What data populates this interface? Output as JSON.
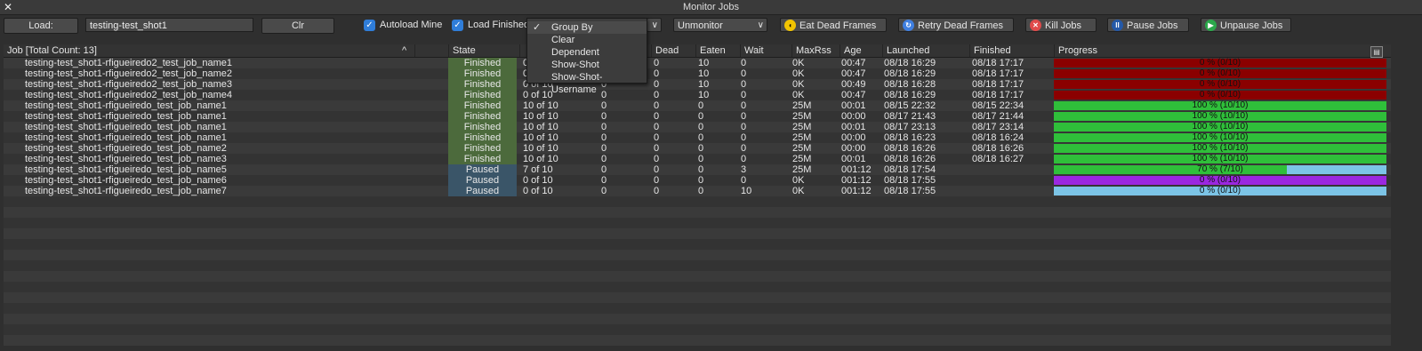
{
  "window": {
    "title": "Monitor Jobs",
    "close_glyph": "✕"
  },
  "toolbar": {
    "load_label": "Load:",
    "search_value": "testing-test_shot1",
    "clear_label": "Clr",
    "autoload_mine_label": "Autoload Mine",
    "autoload_mine_checked": true,
    "load_finished_label": "Load Finished",
    "load_finished_checked": true,
    "unmonitor_label": "Unmonitor",
    "eat_dead_label": "Eat Dead Frames",
    "retry_dead_label": "Retry Dead Frames",
    "kill_label": "Kill Jobs",
    "pause_label": "Pause Jobs",
    "unpause_label": "Unpause Jobs"
  },
  "dropdown": {
    "items": [
      "Group By",
      "Clear",
      "Dependent",
      "Show-Shot",
      "Show-Shot-Username"
    ],
    "checked_item": "Group By"
  },
  "columns": {
    "job": "Job [Total Count: 13]",
    "sort_glyph": "^",
    "state": "State",
    "dead": "Dead",
    "eaten": "Eaten",
    "wait": "Wait",
    "maxrss": "MaxRss",
    "age": "Age",
    "launched": "Launched",
    "finished": "Finished",
    "progress": "Progress"
  },
  "colors": {
    "finished_state": "#4c6a3c",
    "paused_state": "#3a5568",
    "progress_red": "#8b0000",
    "progress_green": "#2fbf3a",
    "progress_purple": "#9b27e0",
    "progress_remaining": "#7cc4e6"
  },
  "jobs": [
    {
      "name": "testing-test_shot1-rfigueiredo2_test_job_name1",
      "state": "Finished",
      "done": "0",
      "c2": "0",
      "dead": "0",
      "eaten": "10",
      "wait": "0",
      "maxrss": "0K",
      "age": "00:47",
      "launched": "08/18 16:29",
      "finished": "08/18 17:17",
      "progress": "0 % (0/10)",
      "fill_pct": 100,
      "fill_color": "red"
    },
    {
      "name": "testing-test_shot1-rfigueiredo2_test_job_name2",
      "state": "Finished",
      "done": "0",
      "c2": "0",
      "dead": "0",
      "eaten": "10",
      "wait": "0",
      "maxrss": "0K",
      "age": "00:47",
      "launched": "08/18 16:29",
      "finished": "08/18 17:17",
      "progress": "0 % (0/10)",
      "fill_pct": 100,
      "fill_color": "red"
    },
    {
      "name": "testing-test_shot1-rfigueiredo2_test_job_name3",
      "state": "Finished",
      "done": "0 of 10",
      "c2": "0",
      "dead": "0",
      "eaten": "10",
      "wait": "0",
      "maxrss": "0K",
      "age": "00:49",
      "launched": "08/18 16:28",
      "finished": "08/18 17:17",
      "progress": "0 % (0/10)",
      "fill_pct": 100,
      "fill_color": "red"
    },
    {
      "name": "testing-test_shot1-rfigueiredo2_test_job_name4",
      "state": "Finished",
      "done": "0 of 10",
      "c2": "0",
      "dead": "0",
      "eaten": "10",
      "wait": "0",
      "maxrss": "0K",
      "age": "00:47",
      "launched": "08/18 16:29",
      "finished": "08/18 17:17",
      "progress": "0 % (0/10)",
      "fill_pct": 100,
      "fill_color": "red"
    },
    {
      "name": "testing-test_shot1-rfigueiredo_test_job_name1",
      "state": "Finished",
      "done": "10 of 10",
      "c2": "0",
      "dead": "0",
      "eaten": "0",
      "wait": "0",
      "maxrss": "25M",
      "age": "00:01",
      "launched": "08/15 22:32",
      "finished": "08/15 22:34",
      "progress": "100 % (10/10)",
      "fill_pct": 100,
      "fill_color": "green"
    },
    {
      "name": "testing-test_shot1-rfigueiredo_test_job_name1",
      "state": "Finished",
      "done": "10 of 10",
      "c2": "0",
      "dead": "0",
      "eaten": "0",
      "wait": "0",
      "maxrss": "25M",
      "age": "00:00",
      "launched": "08/17 21:43",
      "finished": "08/17 21:44",
      "progress": "100 % (10/10)",
      "fill_pct": 100,
      "fill_color": "green"
    },
    {
      "name": "testing-test_shot1-rfigueiredo_test_job_name1",
      "state": "Finished",
      "done": "10 of 10",
      "c2": "0",
      "dead": "0",
      "eaten": "0",
      "wait": "0",
      "maxrss": "25M",
      "age": "00:01",
      "launched": "08/17 23:13",
      "finished": "08/17 23:14",
      "progress": "100 % (10/10)",
      "fill_pct": 100,
      "fill_color": "green"
    },
    {
      "name": "testing-test_shot1-rfigueiredo_test_job_name1",
      "state": "Finished",
      "done": "10 of 10",
      "c2": "0",
      "dead": "0",
      "eaten": "0",
      "wait": "0",
      "maxrss": "25M",
      "age": "00:00",
      "launched": "08/18 16:23",
      "finished": "08/18 16:24",
      "progress": "100 % (10/10)",
      "fill_pct": 100,
      "fill_color": "green"
    },
    {
      "name": "testing-test_shot1-rfigueiredo_test_job_name2",
      "state": "Finished",
      "done": "10 of 10",
      "c2": "0",
      "dead": "0",
      "eaten": "0",
      "wait": "0",
      "maxrss": "25M",
      "age": "00:00",
      "launched": "08/18 16:26",
      "finished": "08/18 16:26",
      "progress": "100 % (10/10)",
      "fill_pct": 100,
      "fill_color": "green"
    },
    {
      "name": "testing-test_shot1-rfigueiredo_test_job_name3",
      "state": "Finished",
      "done": "10 of 10",
      "c2": "0",
      "dead": "0",
      "eaten": "0",
      "wait": "0",
      "maxrss": "25M",
      "age": "00:01",
      "launched": "08/18 16:26",
      "finished": "08/18 16:27",
      "progress": "100 % (10/10)",
      "fill_pct": 100,
      "fill_color": "green"
    },
    {
      "name": "testing-test_shot1-rfigueiredo_test_job_name5",
      "state": "Paused",
      "done": "7 of 10",
      "c2": "0",
      "dead": "0",
      "eaten": "0",
      "wait": "3",
      "maxrss": "25M",
      "age": "001:12",
      "launched": "08/18 17:54",
      "finished": "",
      "progress": "70 % (7/10)",
      "fill_pct": 70,
      "fill_color": "green"
    },
    {
      "name": "testing-test_shot1-rfigueiredo_test_job_name6",
      "state": "Paused",
      "done": "0 of 10",
      "c2": "0",
      "dead": "0",
      "eaten": "0",
      "wait": "0",
      "maxrss": "0K",
      "age": "001:12",
      "launched": "08/18 17:55",
      "finished": "",
      "progress": "0 % (0/10)",
      "fill_pct": 100,
      "fill_color": "purple"
    },
    {
      "name": "testing-test_shot1-rfigueiredo_test_job_name7",
      "state": "Paused",
      "done": "0 of 10",
      "c2": "0",
      "dead": "0",
      "eaten": "0",
      "wait": "10",
      "maxrss": "0K",
      "age": "001:12",
      "launched": "08/18 17:55",
      "finished": "",
      "progress": "0 % (0/10)",
      "fill_pct": 0,
      "fill_color": "green"
    }
  ]
}
